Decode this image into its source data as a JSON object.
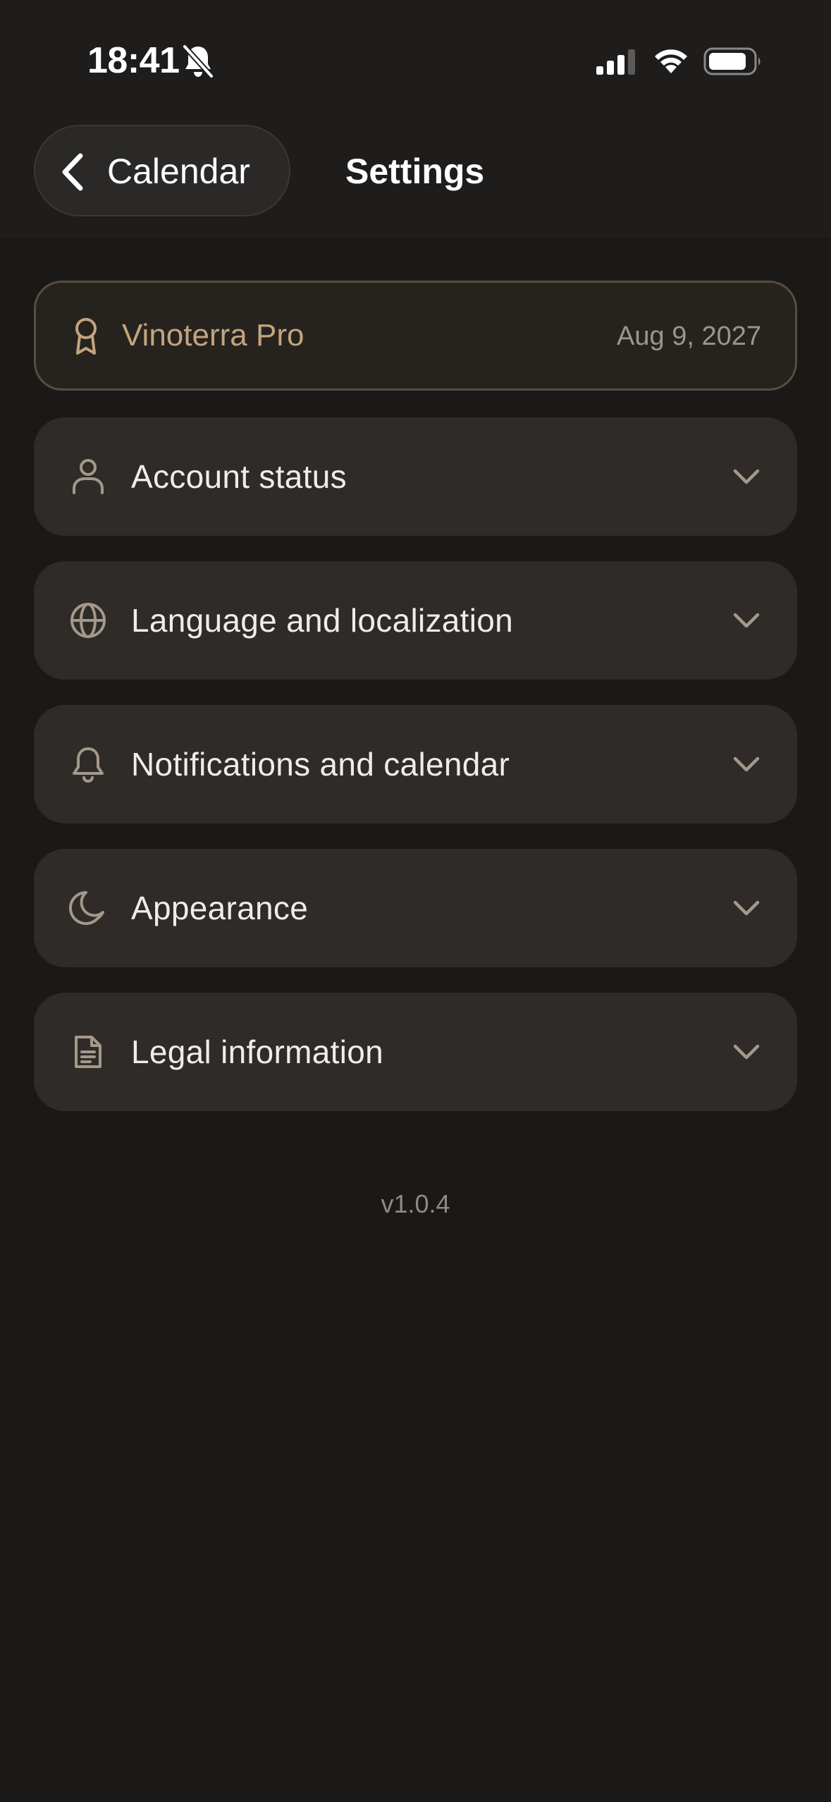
{
  "status_bar": {
    "time": "18:41",
    "icons": [
      "bell-slash-icon",
      "cellular-signal-icon",
      "wifi-icon",
      "battery-icon"
    ]
  },
  "header": {
    "back_label": "Calendar",
    "title": "Settings"
  },
  "pro_card": {
    "label": "Vinoterra Pro",
    "date": "Aug 9, 2027",
    "icon": "award-ribbon-icon"
  },
  "sections": [
    {
      "label": "Account status",
      "icon": "user-icon"
    },
    {
      "label": "Language and localization",
      "icon": "globe-icon"
    },
    {
      "label": "Notifications and calendar",
      "icon": "bell-icon"
    },
    {
      "label": "Appearance",
      "icon": "moon-icon"
    },
    {
      "label": "Legal information",
      "icon": "document-icon"
    }
  ],
  "footer": {
    "version": "v1.0.4"
  },
  "colors": {
    "background": "#1a1918",
    "header_background": "#1e1d1c",
    "card_background": "#2e2b28",
    "accent_gold": "#c4a47e",
    "icon_tint": "#a3988b",
    "text_primary": "#f1ece6",
    "text_muted": "#9b958d"
  }
}
